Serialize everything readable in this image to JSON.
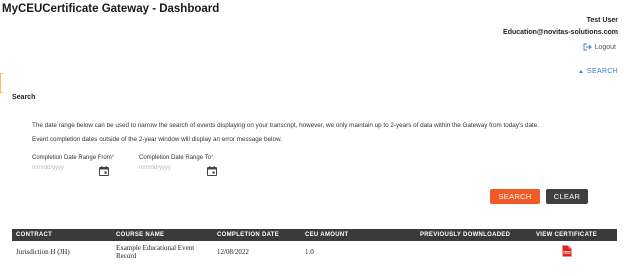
{
  "header": {
    "title": "MyCEUCertificate Gateway - Dashboard",
    "user_name": "Test User",
    "user_email": "Education@novitas-solutions.com",
    "logout_label": "Logout"
  },
  "search_panel": {
    "toggle_label": "SEARCH",
    "section_label": "Search",
    "description_line1": "The date range below can be used to narrow the search of events displaying on your transcript, however, we only maintain up to 2-years of data within the Gateway from today's date.",
    "description_line2": "Event completion dates outside of the 2-year window will display an error message below.",
    "from_label": "Completion Date Range From",
    "to_label": "Completion Date Range To",
    "required_mark": "*",
    "from_placeholder": "mm/dd/yyyy",
    "to_placeholder": "mm/dd/yyyy",
    "search_button": "SEARCH",
    "clear_button": "CLEAR"
  },
  "table": {
    "headers": [
      "CONTRACT",
      "COURSE NAME",
      "COMPLETION DATE",
      "CEU AMOUNT",
      "PREVIOUSLY DOWNLOADED",
      "VIEW CERTIFICATE"
    ],
    "rows": [
      {
        "contract": "Jurisdiction H (JH)",
        "course_name": "Example Educational Event Record",
        "completion_date": "12/08/2022",
        "ceu_amount": "1.0",
        "previously_downloaded": "",
        "view_icon": "pdf-icon"
      }
    ]
  },
  "colors": {
    "accent_blue": "#3b7dd8",
    "search_button": "#f05a24",
    "clear_button": "#404040",
    "table_header": "#3a3a3a",
    "pdf_red": "#e0201b"
  }
}
